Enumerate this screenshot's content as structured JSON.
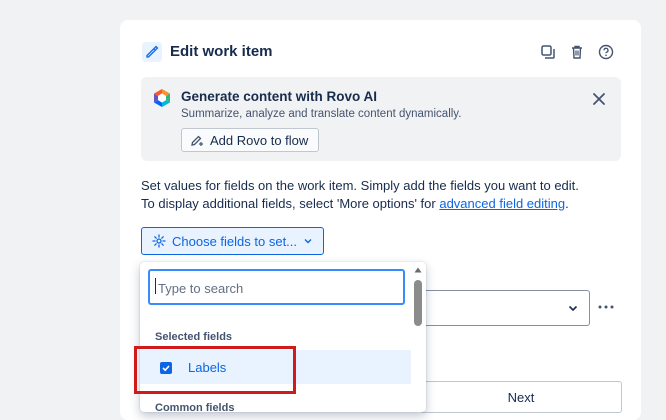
{
  "header": {
    "title": "Edit work item",
    "icons": [
      "edit-icon",
      "duplicate-icon",
      "trash-icon",
      "help-icon"
    ]
  },
  "rovo": {
    "title": "Generate content with Rovo AI",
    "subtitle": "Summarize, analyze and translate content dynamically.",
    "button_label": "Add Rovo to flow"
  },
  "description": {
    "line1": "Set values for fields on the work item. Simply add the fields you want to edit.",
    "line2_prefix": "To display additional fields, select 'More options' for ",
    "link_text": "advanced field editing",
    "line2_suffix": "."
  },
  "fields_button": {
    "label": "Choose fields to set..."
  },
  "dropdown": {
    "search_placeholder": "Type to search",
    "search_value": "",
    "selected_heading": "Selected fields",
    "options": [
      {
        "label": "Labels",
        "checked": true
      }
    ],
    "next_heading": "Common fields"
  },
  "footer": {
    "next_label": "Next"
  },
  "colors": {
    "accent": "#0c66e4",
    "highlight": "#d11a1a",
    "panel_bg": "#ffffff",
    "page_bg": "#f1f2f4"
  }
}
